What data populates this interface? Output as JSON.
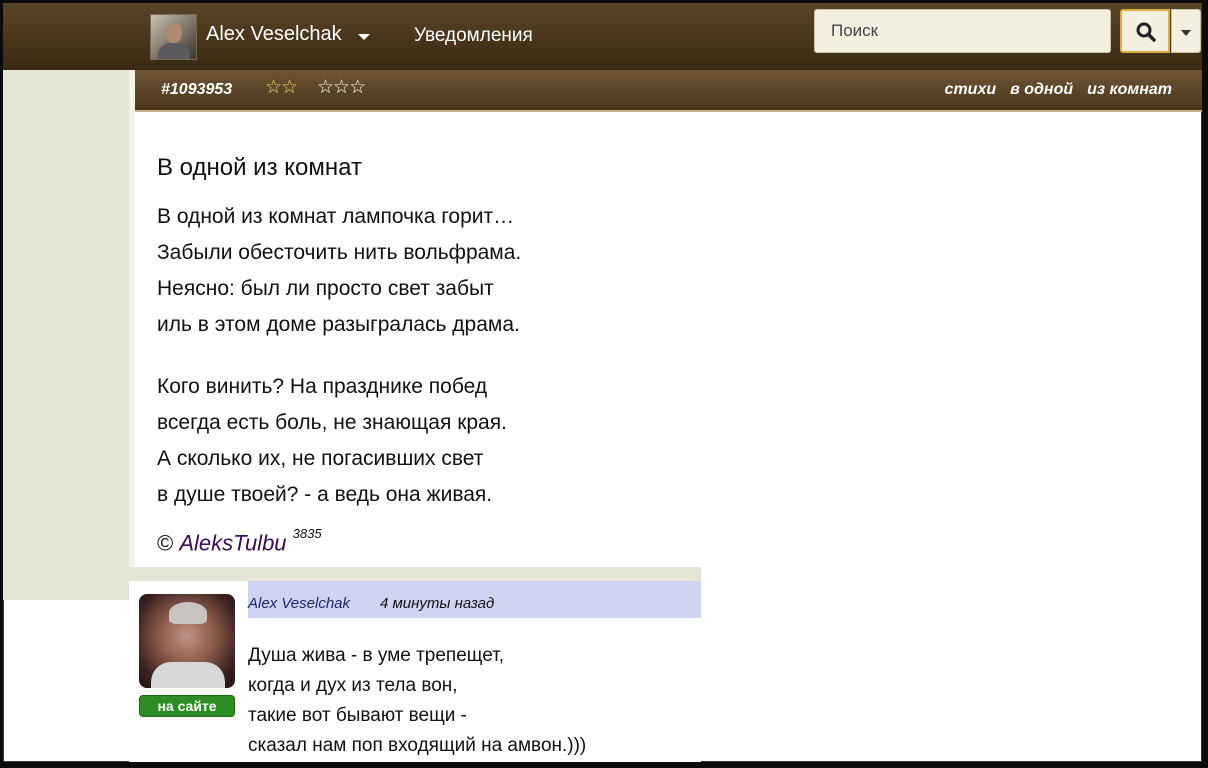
{
  "nav": {
    "user_name": "Alex Veselchak",
    "notifications_label": "Уведомления",
    "search_placeholder": "Поиск"
  },
  "post": {
    "id": "#1093953",
    "stars_rated": "☆☆",
    "stars_unrated": "☆☆☆",
    "tags": [
      "стихи",
      "в одной",
      "из комнат"
    ],
    "title": "В одной из комнат",
    "stanzas": [
      [
        "В одной из комнат лампочка горит…",
        "Забыли обесточить нить вольфрама.",
        "Неясно: был ли просто свет забыт",
        "иль в этом доме разыгралась драма."
      ],
      [
        "Кого винить? На празднике побед",
        "всегда есть боль, не знающая края.",
        "А сколько их, не погасивших свет",
        "в душе твоей? - а ведь она живая."
      ]
    ],
    "copyright_symbol": "©",
    "author": "AleksTulbu",
    "author_rating": "3835"
  },
  "comment": {
    "user": "Alex Veselchak",
    "time": "4 минуты назад",
    "status": "на сайте",
    "lines": [
      "Душа жива - в уме трепещет,",
      "когда и дух из тела вон,",
      "такие вот бывают вещи -",
      "сказал нам поп входящий на амвон.)))"
    ]
  }
}
